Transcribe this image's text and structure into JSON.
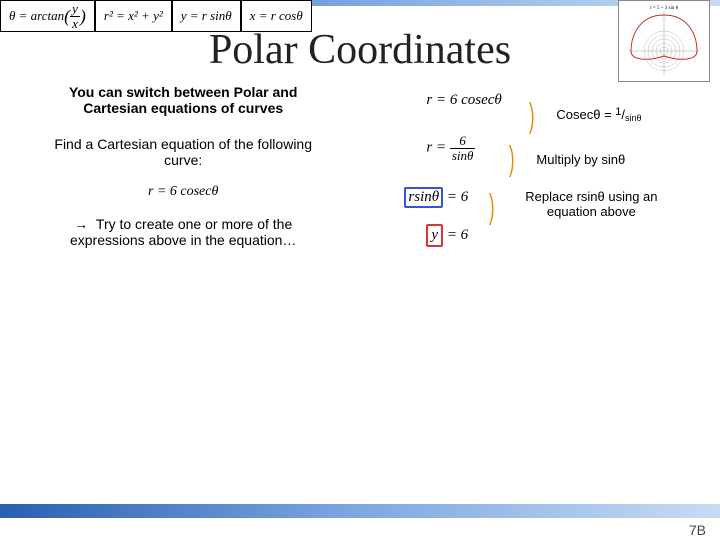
{
  "formulas": {
    "f1_lhs": "θ = arctan",
    "f1_num": "y",
    "f1_den": "x",
    "f2": "r² = x² + y²",
    "f3": "y = r sinθ",
    "f4": "x = r cosθ"
  },
  "polar_graph_caption": "r = 5 + 3 sin θ",
  "title": "Polar Coordinates",
  "left": {
    "heading": "You can switch between Polar and Cartesian equations of curves",
    "sub": "Find a Cartesian equation of the following curve:",
    "eq": "r = 6 cosecθ",
    "tip_arrow": "→",
    "tip": "Try to create one or more of the expressions above in the equation…"
  },
  "right": {
    "eq1": "r = 6 cosecθ",
    "note1_a": "Cosecθ = ",
    "note1_b": "1",
    "note1_c": "/",
    "note1_d": "sinθ",
    "eq2_lhs": "r = ",
    "eq2_num": "6",
    "eq2_den": "sinθ",
    "note2": "Multiply by sinθ",
    "eq3_lhs": "rsinθ",
    "eq3_rhs": " = 6",
    "note3": "Replace rsinθ using an equation above",
    "eq4_lhs": "y",
    "eq4_rhs": " = 6"
  },
  "page": "7B"
}
